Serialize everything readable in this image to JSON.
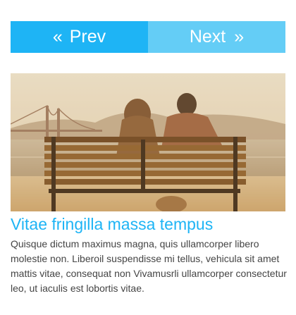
{
  "pager": {
    "prev_label": "Prev",
    "next_label": "Next",
    "prev_icon": "double-chevron-left-icon",
    "next_icon": "double-chevron-right-icon",
    "prev_glyph": "«",
    "next_glyph": "»"
  },
  "article": {
    "title": "Vitae fringilla massa tempus",
    "body": "Quisque dictum maximus magna, quis ullamcorper libero molestie non. Liberoil suspendisse mi tellus, vehicula sit amet mattis vitae, consequat non Vivamusrli ullamcorper consectetur leo, ut iaculis est lobortis vitae."
  },
  "colors": {
    "accent": "#1eb4f5",
    "accent_light": "#64cdf6",
    "text": "#444444"
  }
}
